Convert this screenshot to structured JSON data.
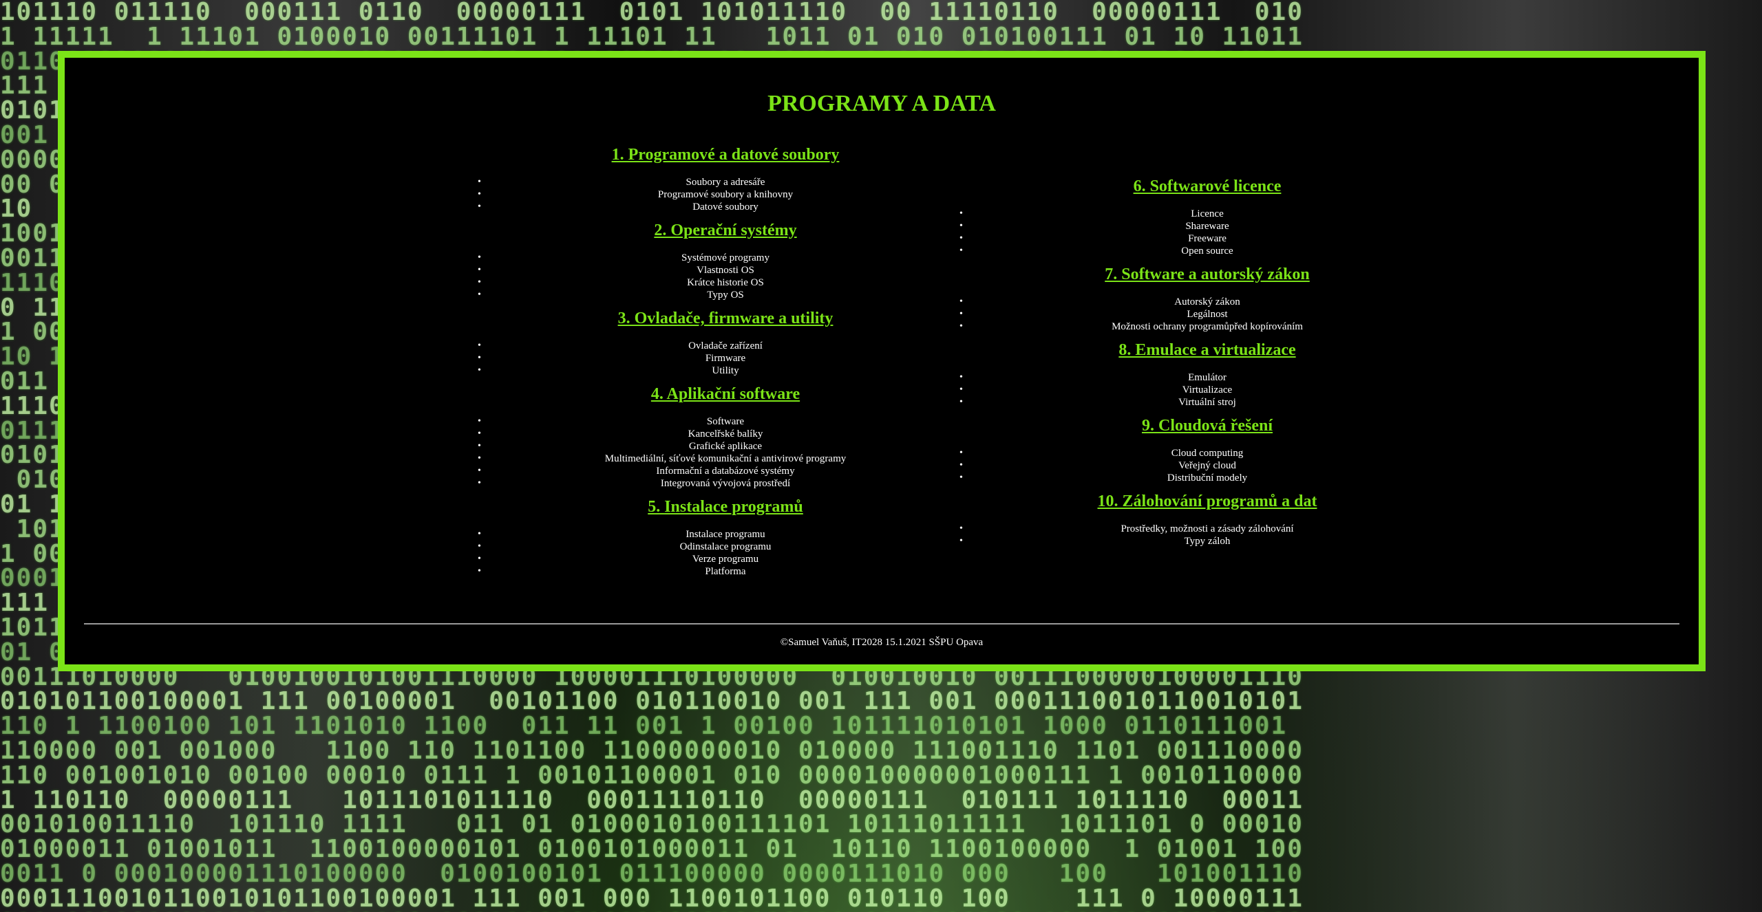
{
  "page": {
    "title": "PROGRAMY A DATA",
    "footer": "©Samuel Vaňuš, IT2028 15.1.2021 SŠPU Opava"
  },
  "colors": {
    "accent": "#7be317",
    "panel_background": "#000000",
    "text": "#ffffff"
  },
  "sections_left": [
    {
      "title": "1. Programové a datové soubory",
      "items": [
        "Soubory a adresáře",
        "Programové soubory a knihovny",
        "Datové soubory"
      ]
    },
    {
      "title": "2. Operační systémy",
      "items": [
        "Systémové programy",
        "Vlastnosti OS",
        "Krátce historie OS",
        "Typy OS"
      ]
    },
    {
      "title": "3. Ovladače, firmware a utility",
      "items": [
        "Ovladače zařízení",
        "Firmware",
        "Utility"
      ]
    },
    {
      "title": "4. Aplikační software",
      "items": [
        "Software",
        "Kancelřské balíky",
        "Grafické aplikace",
        "Multimediální, síťové komunikační a antivirové programy",
        "Informační a databázové systémy",
        "Integrovaná vývojová prostředí"
      ]
    },
    {
      "title": "5. Instalace programů",
      "items": [
        "Instalace programu",
        "Odinstalace programu",
        "Verze programu",
        "Platforma"
      ]
    }
  ],
  "sections_right": [
    {
      "title": "6. Softwarové licence",
      "items": [
        "Licence",
        "Shareware",
        "Freeware",
        "Open source"
      ]
    },
    {
      "title": "7. Software a autorský zákon",
      "items": [
        "Autorský zákon",
        "Legálnost",
        "Možnosti ochrany programůpřed kopírováním"
      ]
    },
    {
      "title": "8. Emulace a virtualizace",
      "items": [
        "Emulátor",
        "Virtualizace",
        "Virtuální stroj"
      ]
    },
    {
      "title": "9. Cloudová řešení",
      "items": [
        "Cloud computing",
        "Veřejný cloud",
        "Distribuční modely"
      ]
    },
    {
      "title": "10. Zálohování programů a dat",
      "items": [
        "Prostředky, možnosti a zásady zálohování",
        "Typy záloh"
      ]
    }
  ]
}
